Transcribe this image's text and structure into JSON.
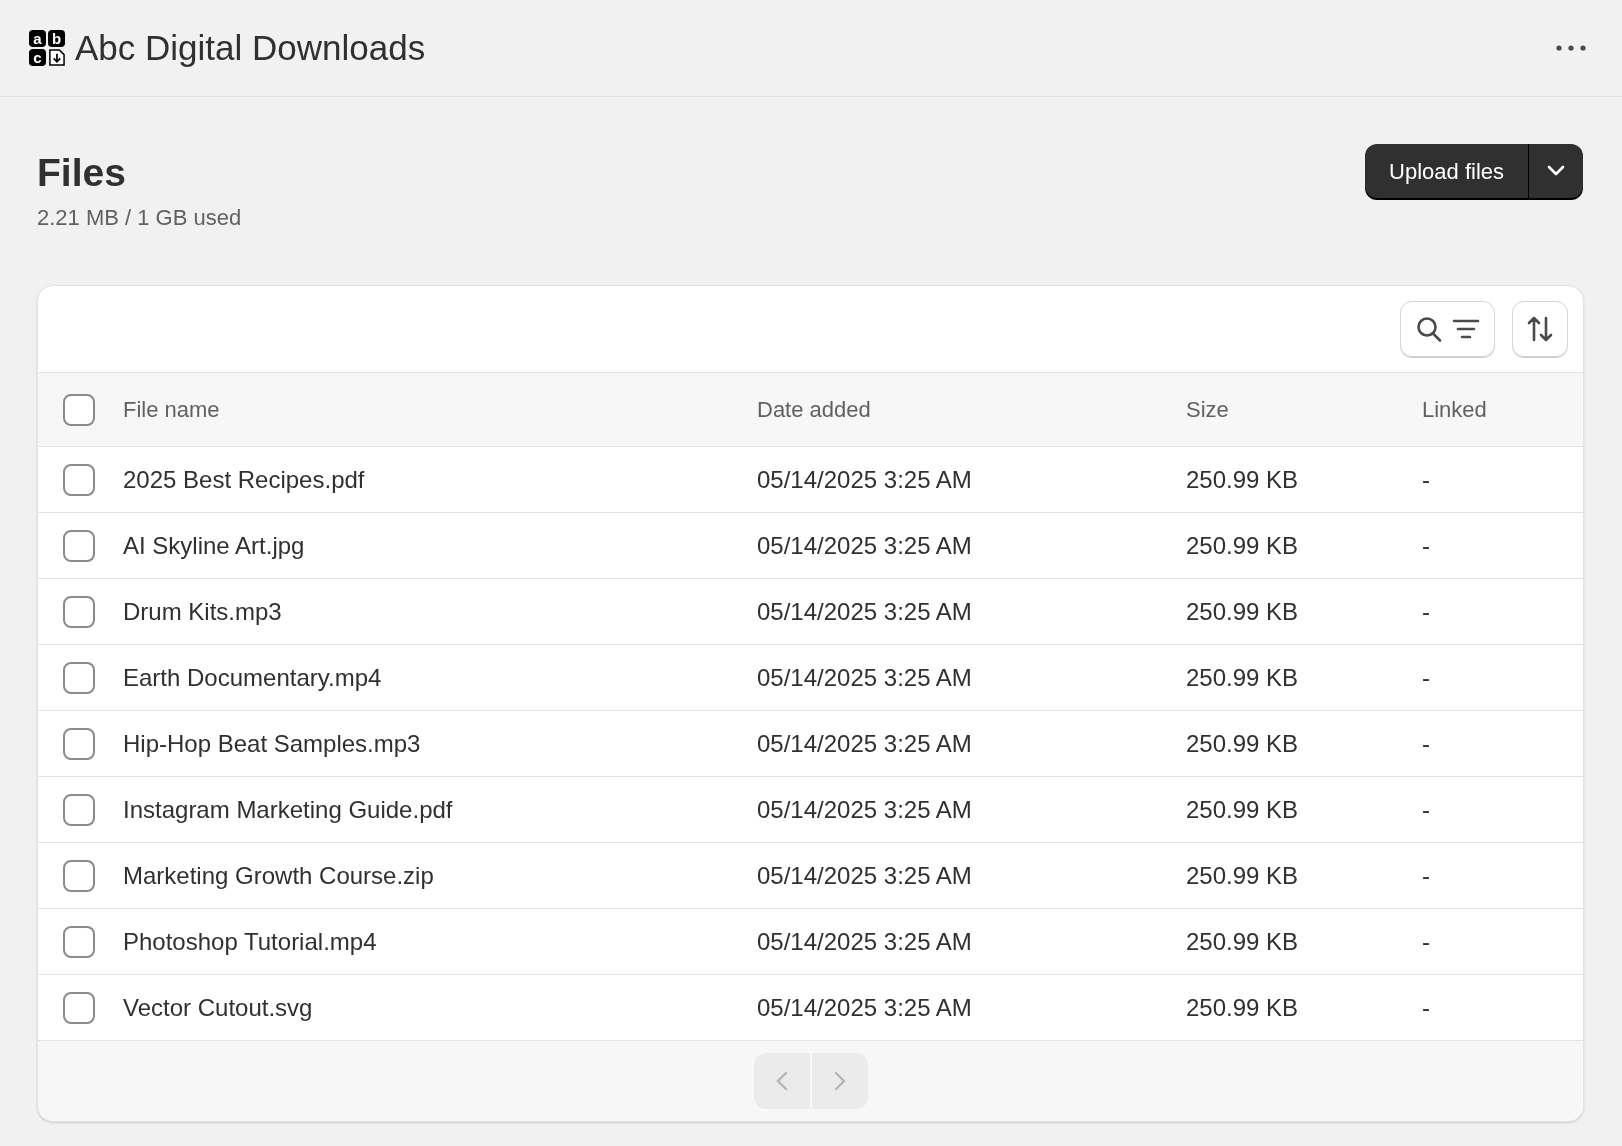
{
  "app": {
    "logo_letters": [
      "a",
      "b",
      "c"
    ],
    "title": "Abc Digital Downloads"
  },
  "page": {
    "title": "Files",
    "usage": "2.21 MB / 1 GB used",
    "upload_button": "Upload files"
  },
  "table": {
    "columns": [
      "File name",
      "Date added",
      "Size",
      "Linked"
    ],
    "header_checked": false,
    "rows": [
      {
        "name": "2025 Best Recipes.pdf",
        "date": "05/14/2025 3:25 AM",
        "size": "250.99 KB",
        "linked": "-",
        "checked": false
      },
      {
        "name": "AI Skyline Art.jpg",
        "date": "05/14/2025 3:25 AM",
        "size": "250.99 KB",
        "linked": "-",
        "checked": false
      },
      {
        "name": "Drum Kits.mp3",
        "date": "05/14/2025 3:25 AM",
        "size": "250.99 KB",
        "linked": "-",
        "checked": false
      },
      {
        "name": "Earth Documentary.mp4",
        "date": "05/14/2025 3:25 AM",
        "size": "250.99 KB",
        "linked": "-",
        "checked": false
      },
      {
        "name": "Hip-Hop Beat Samples.mp3",
        "date": "05/14/2025 3:25 AM",
        "size": "250.99 KB",
        "linked": "-",
        "checked": false
      },
      {
        "name": "Instagram Marketing Guide.pdf",
        "date": "05/14/2025 3:25 AM",
        "size": "250.99 KB",
        "linked": "-",
        "checked": false
      },
      {
        "name": "Marketing Growth Course.zip",
        "date": "05/14/2025 3:25 AM",
        "size": "250.99 KB",
        "linked": "-",
        "checked": false
      },
      {
        "name": "Photoshop Tutorial.mp4",
        "date": "05/14/2025 3:25 AM",
        "size": "250.99 KB",
        "linked": "-",
        "checked": false
      },
      {
        "name": "Vector Cutout.svg",
        "date": "05/14/2025 3:25 AM",
        "size": "250.99 KB",
        "linked": "-",
        "checked": false
      }
    ]
  },
  "pagination": {
    "previous_disabled": true,
    "next_disabled": true
  }
}
